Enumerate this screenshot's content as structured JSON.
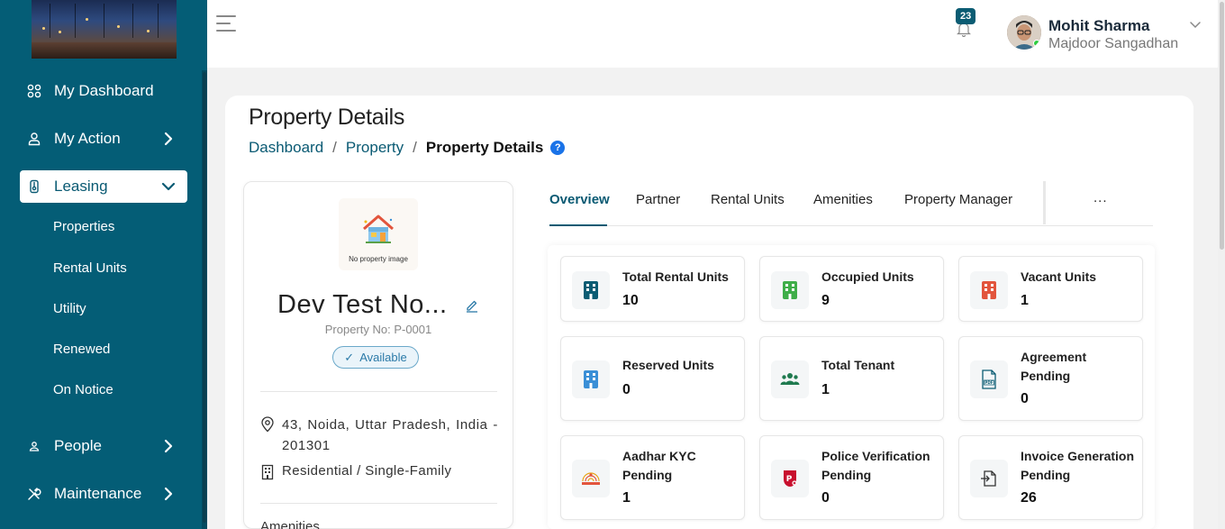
{
  "sidebar": {
    "items": [
      {
        "label": "My Dashboard",
        "icon": "grid-icon"
      },
      {
        "label": "My Action",
        "icon": "user-action-icon"
      },
      {
        "label": "Leasing",
        "icon": "lease-icon"
      },
      {
        "label": "People",
        "icon": "person-icon"
      },
      {
        "label": "Maintenance",
        "icon": "tools-icon"
      }
    ],
    "leasing_sub": [
      "Properties",
      "Rental Units",
      "Utility",
      "Renewed",
      "On Notice"
    ]
  },
  "topbar": {
    "notification_count": "23",
    "user_name": "Mohit Sharma",
    "user_org": "Majdoor Sangadhan"
  },
  "page": {
    "title": "Property Details",
    "breadcrumb": [
      "Dashboard",
      "Property",
      "Property Details"
    ],
    "help": "?"
  },
  "property": {
    "image_caption": "No property image",
    "name": "Dev Test No...",
    "number": "Property No: P-0001",
    "status": "Available",
    "address": "43, Noida, Uttar Pradesh, India - 201301",
    "type": "Residential / Single-Family",
    "amenities_label": "Amenities"
  },
  "tabs": [
    "Overview",
    "Partner",
    "Rental Units",
    "Amenities",
    "Property Manager"
  ],
  "tabs_more": "...",
  "stats": [
    {
      "label": "Total Rental Units",
      "value": "10",
      "icon": "building-icon",
      "color": "#0b5c73"
    },
    {
      "label": "Occupied Units",
      "value": "9",
      "icon": "building-icon",
      "color": "#3fae49"
    },
    {
      "label": "Vacant Units",
      "value": "1",
      "icon": "building-icon",
      "color": "#e2553d"
    },
    {
      "label": "Reserved Units",
      "value": "0",
      "icon": "building-icon",
      "color": "#3a8fd6"
    },
    {
      "label": "Total Tenant",
      "value": "1",
      "icon": "group-icon",
      "color": "#1f7a4f"
    },
    {
      "label": "Agreement Pending",
      "value": "0",
      "icon": "pdf-icon",
      "color": "#0b5c73"
    },
    {
      "label": "Aadhar KYC Pending",
      "value": "1",
      "icon": "aadhaar-icon",
      "color": "#e8a317"
    },
    {
      "label": "Police Verification Pending",
      "value": "0",
      "icon": "police-icon",
      "color": "#c8102e"
    },
    {
      "label": "Invoice Generation Pending",
      "value": "26",
      "icon": "invoice-icon",
      "color": "#333333"
    }
  ]
}
